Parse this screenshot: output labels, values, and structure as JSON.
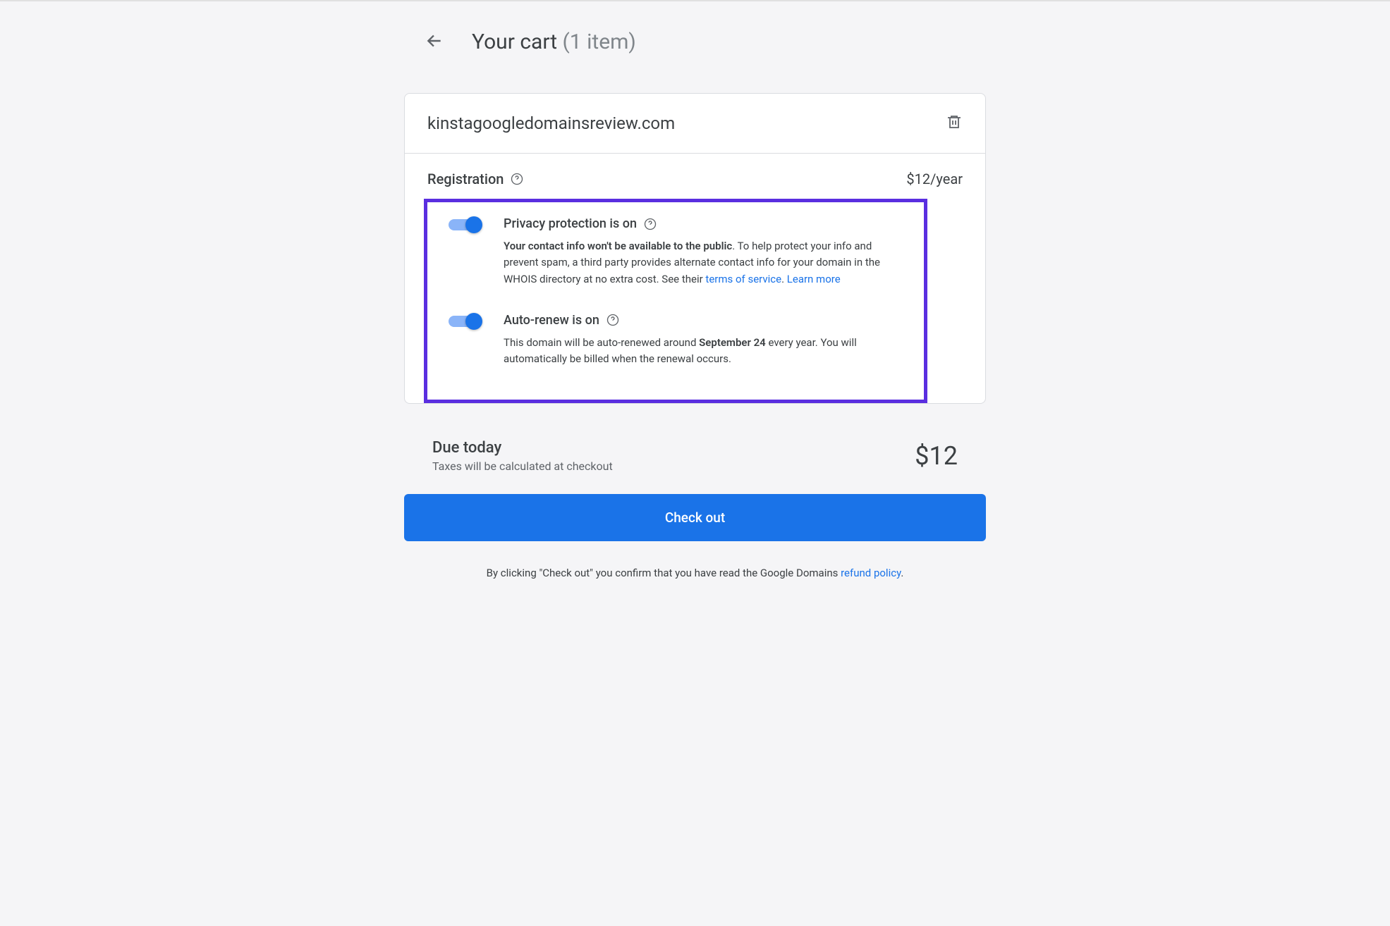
{
  "header": {
    "title": "Your cart",
    "count": "(1 item)"
  },
  "domain": {
    "name": "kinstagoogledomainsreview.com"
  },
  "registration": {
    "label": "Registration",
    "price": "$12/year"
  },
  "privacy": {
    "title": "Privacy protection is on",
    "desc_bold": "Your contact info won't be available to the public",
    "desc_rest": ". To help protect your info and prevent spam, a third party provides alternate contact info for your domain in the WHOIS directory at no extra cost. See their ",
    "terms_link": "terms of service",
    "period": ". ",
    "learn_more": "Learn more"
  },
  "autorenew": {
    "title": "Auto-renew is on",
    "desc_pre": "This domain will be auto-renewed around ",
    "date": "September 24",
    "desc_post": " every year. You will automatically be billed when the renewal occurs."
  },
  "due": {
    "label": "Due today",
    "sub": "Taxes will be calculated at checkout",
    "amount": "$12"
  },
  "checkout": {
    "label": "Check out"
  },
  "disclaimer": {
    "pre": "By clicking \"Check out\" you confirm that you have read the Google Domains ",
    "link": "refund policy",
    "post": "."
  }
}
